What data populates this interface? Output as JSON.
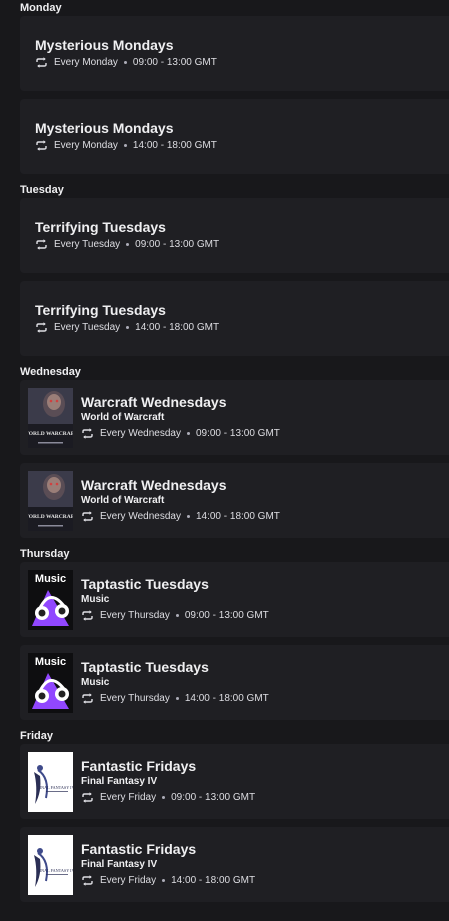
{
  "days": [
    {
      "name": "Monday",
      "events": [
        {
          "title": "Mysterious Mondays",
          "category": "",
          "recurrence": "Every Monday",
          "time": "09:00 - 13:00 GMT",
          "art": "none"
        },
        {
          "title": "Mysterious Mondays",
          "category": "",
          "recurrence": "Every Monday",
          "time": "14:00 - 18:00 GMT",
          "art": "none"
        }
      ]
    },
    {
      "name": "Tuesday",
      "events": [
        {
          "title": "Terrifying Tuesdays",
          "category": "",
          "recurrence": "Every Tuesday",
          "time": "09:00 - 13:00 GMT",
          "art": "none"
        },
        {
          "title": "Terrifying Tuesdays",
          "category": "",
          "recurrence": "Every Tuesday",
          "time": "14:00 - 18:00 GMT",
          "art": "none"
        }
      ]
    },
    {
      "name": "Wednesday",
      "events": [
        {
          "title": "Warcraft Wednesdays",
          "category": "World of Warcraft",
          "recurrence": "Every Wednesday",
          "time": "09:00 - 13:00 GMT",
          "art": "wow",
          "art_text": "WORLD WARCRAFT"
        },
        {
          "title": "Warcraft Wednesdays",
          "category": "World of Warcraft",
          "recurrence": "Every Wednesday",
          "time": "14:00 - 18:00 GMT",
          "art": "wow",
          "art_text": "WORLD WARCRAFT"
        }
      ]
    },
    {
      "name": "Thursday",
      "events": [
        {
          "title": "Taptastic Tuesdays",
          "category": "Music",
          "recurrence": "Every Thursday",
          "time": "09:00 - 13:00 GMT",
          "art": "music",
          "art_text": "Music"
        },
        {
          "title": "Taptastic Tuesdays",
          "category": "Music",
          "recurrence": "Every Thursday",
          "time": "14:00 - 18:00 GMT",
          "art": "music",
          "art_text": "Music"
        }
      ]
    },
    {
      "name": "Friday",
      "events": [
        {
          "title": "Fantastic Fridays",
          "category": "Final Fantasy IV",
          "recurrence": "Every Friday",
          "time": "09:00 - 13:00 GMT",
          "art": "ff",
          "art_text": "FINAL FANTASY IV"
        },
        {
          "title": "Fantastic Fridays",
          "category": "Final Fantasy IV",
          "recurrence": "Every Friday",
          "time": "14:00 - 18:00 GMT",
          "art": "ff",
          "art_text": "FINAL FANTASY IV"
        }
      ]
    }
  ],
  "colors": {
    "background": "#18181b",
    "card": "#1f1f23",
    "text": "#efeff1",
    "accent_purple": "#9147ff"
  }
}
